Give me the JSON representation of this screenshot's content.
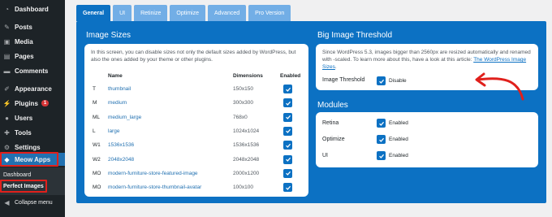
{
  "sidebar": {
    "items": [
      {
        "label": "Dashboard",
        "icon": "dashboard-icon"
      },
      {
        "label": "Posts",
        "icon": "pin-icon"
      },
      {
        "label": "Media",
        "icon": "media-icon"
      },
      {
        "label": "Pages",
        "icon": "pages-icon"
      },
      {
        "label": "Comments",
        "icon": "comments-icon"
      },
      {
        "label": "Appearance",
        "icon": "brush-icon"
      },
      {
        "label": "Plugins",
        "icon": "plugin-icon",
        "badge": "1"
      },
      {
        "label": "Users",
        "icon": "users-icon"
      },
      {
        "label": "Tools",
        "icon": "wrench-icon"
      },
      {
        "label": "Settings",
        "icon": "settings-icon"
      },
      {
        "label": "Meow Apps",
        "icon": "meow-icon"
      }
    ],
    "submenu": [
      {
        "label": "Dashboard"
      },
      {
        "label": "Perfect Images"
      }
    ],
    "collapse_label": "Collapse menu"
  },
  "tabs": [
    "General",
    "UI",
    "Retinize",
    "Optimize",
    "Advanced",
    "Pro Version"
  ],
  "image_sizes": {
    "title": "Image Sizes",
    "description": "In this screen, you can disable sizes not only the default sizes added by WordPress, but also the ones added by your theme or other plugins.",
    "columns": {
      "name": "Name",
      "dimensions": "Dimensions",
      "enabled": "Enabled"
    },
    "rows": [
      {
        "code": "T",
        "name": "thumbnail",
        "dims": "150x150"
      },
      {
        "code": "M",
        "name": "medium",
        "dims": "300x300"
      },
      {
        "code": "ML",
        "name": "medium_large",
        "dims": "768x0"
      },
      {
        "code": "L",
        "name": "large",
        "dims": "1024x1024"
      },
      {
        "code": "W1",
        "name": "1536x1536",
        "dims": "1536x1536"
      },
      {
        "code": "W2",
        "name": "2048x2048",
        "dims": "2048x2048"
      },
      {
        "code": "MO",
        "name": "modern-furniture-store-featured-image",
        "dims": "2000x1200"
      },
      {
        "code": "MO",
        "name": "modern-furniture-store-thumbnail-avatar",
        "dims": "100x100"
      }
    ]
  },
  "big_image": {
    "title": "Big Image Threshold",
    "description_prefix": "Since WordPress 5.3, images bigger than 2560px are resized automatically and renamed with -scaled. To learn more about this, have a look at this article: ",
    "link_text": "The WordPress Image Sizes",
    "description_suffix": ".",
    "option_label": "Image Threshold",
    "option_value": "Disable"
  },
  "modules": {
    "title": "Modules",
    "items": [
      {
        "label": "Retina",
        "value": "Enabled"
      },
      {
        "label": "Optimize",
        "value": "Enabled"
      },
      {
        "label": "UI",
        "value": "Enabled"
      }
    ]
  },
  "colors": {
    "accent": "#0c71c3",
    "sidebar": "#1d2327",
    "highlight": "#e0201c"
  }
}
